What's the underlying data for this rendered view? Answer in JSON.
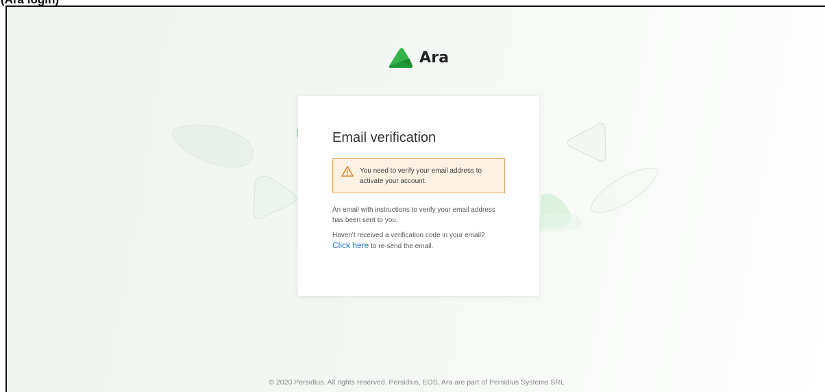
{
  "page": {
    "caption": "(Ara login)"
  },
  "brand": {
    "name": "Ara",
    "logo_icon": "ara-logo-icon",
    "accent_color": "#21a93a"
  },
  "card": {
    "title": "Email verification",
    "alert": {
      "icon": "warning-triangle-icon",
      "color": "#e8892e",
      "line1": "You need to verify your email address to",
      "line2": "activate your account."
    },
    "info_line1": "An email with instructions to verify your email address",
    "info_line2": "has been sent to you.",
    "resend_question": "Haven't received a verification code in your email?",
    "resend_link_label": "Click here",
    "resend_suffix": " to re-send the email."
  },
  "footer": {
    "text": "© 2020 Persidius. All rights reserved. Persidius, EOS, Ara are part of Persidius Systems SRL"
  }
}
